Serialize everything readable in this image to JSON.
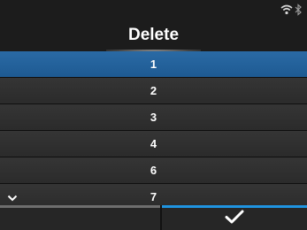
{
  "status": {
    "icons": [
      "wifi-icon",
      "bluetooth-icon"
    ]
  },
  "header": {
    "title": "Delete"
  },
  "list": {
    "items": [
      {
        "label": "1",
        "selected": true
      },
      {
        "label": "2",
        "selected": false
      },
      {
        "label": "3",
        "selected": false
      },
      {
        "label": "4",
        "selected": false
      },
      {
        "label": "6",
        "selected": false
      },
      {
        "label": "7",
        "selected": false
      }
    ]
  },
  "footer": {
    "left": "",
    "confirm": "check-icon"
  },
  "colors": {
    "accent": "#1f94e0",
    "selected_row": "#2566a0",
    "background": "#1c1c1c"
  }
}
